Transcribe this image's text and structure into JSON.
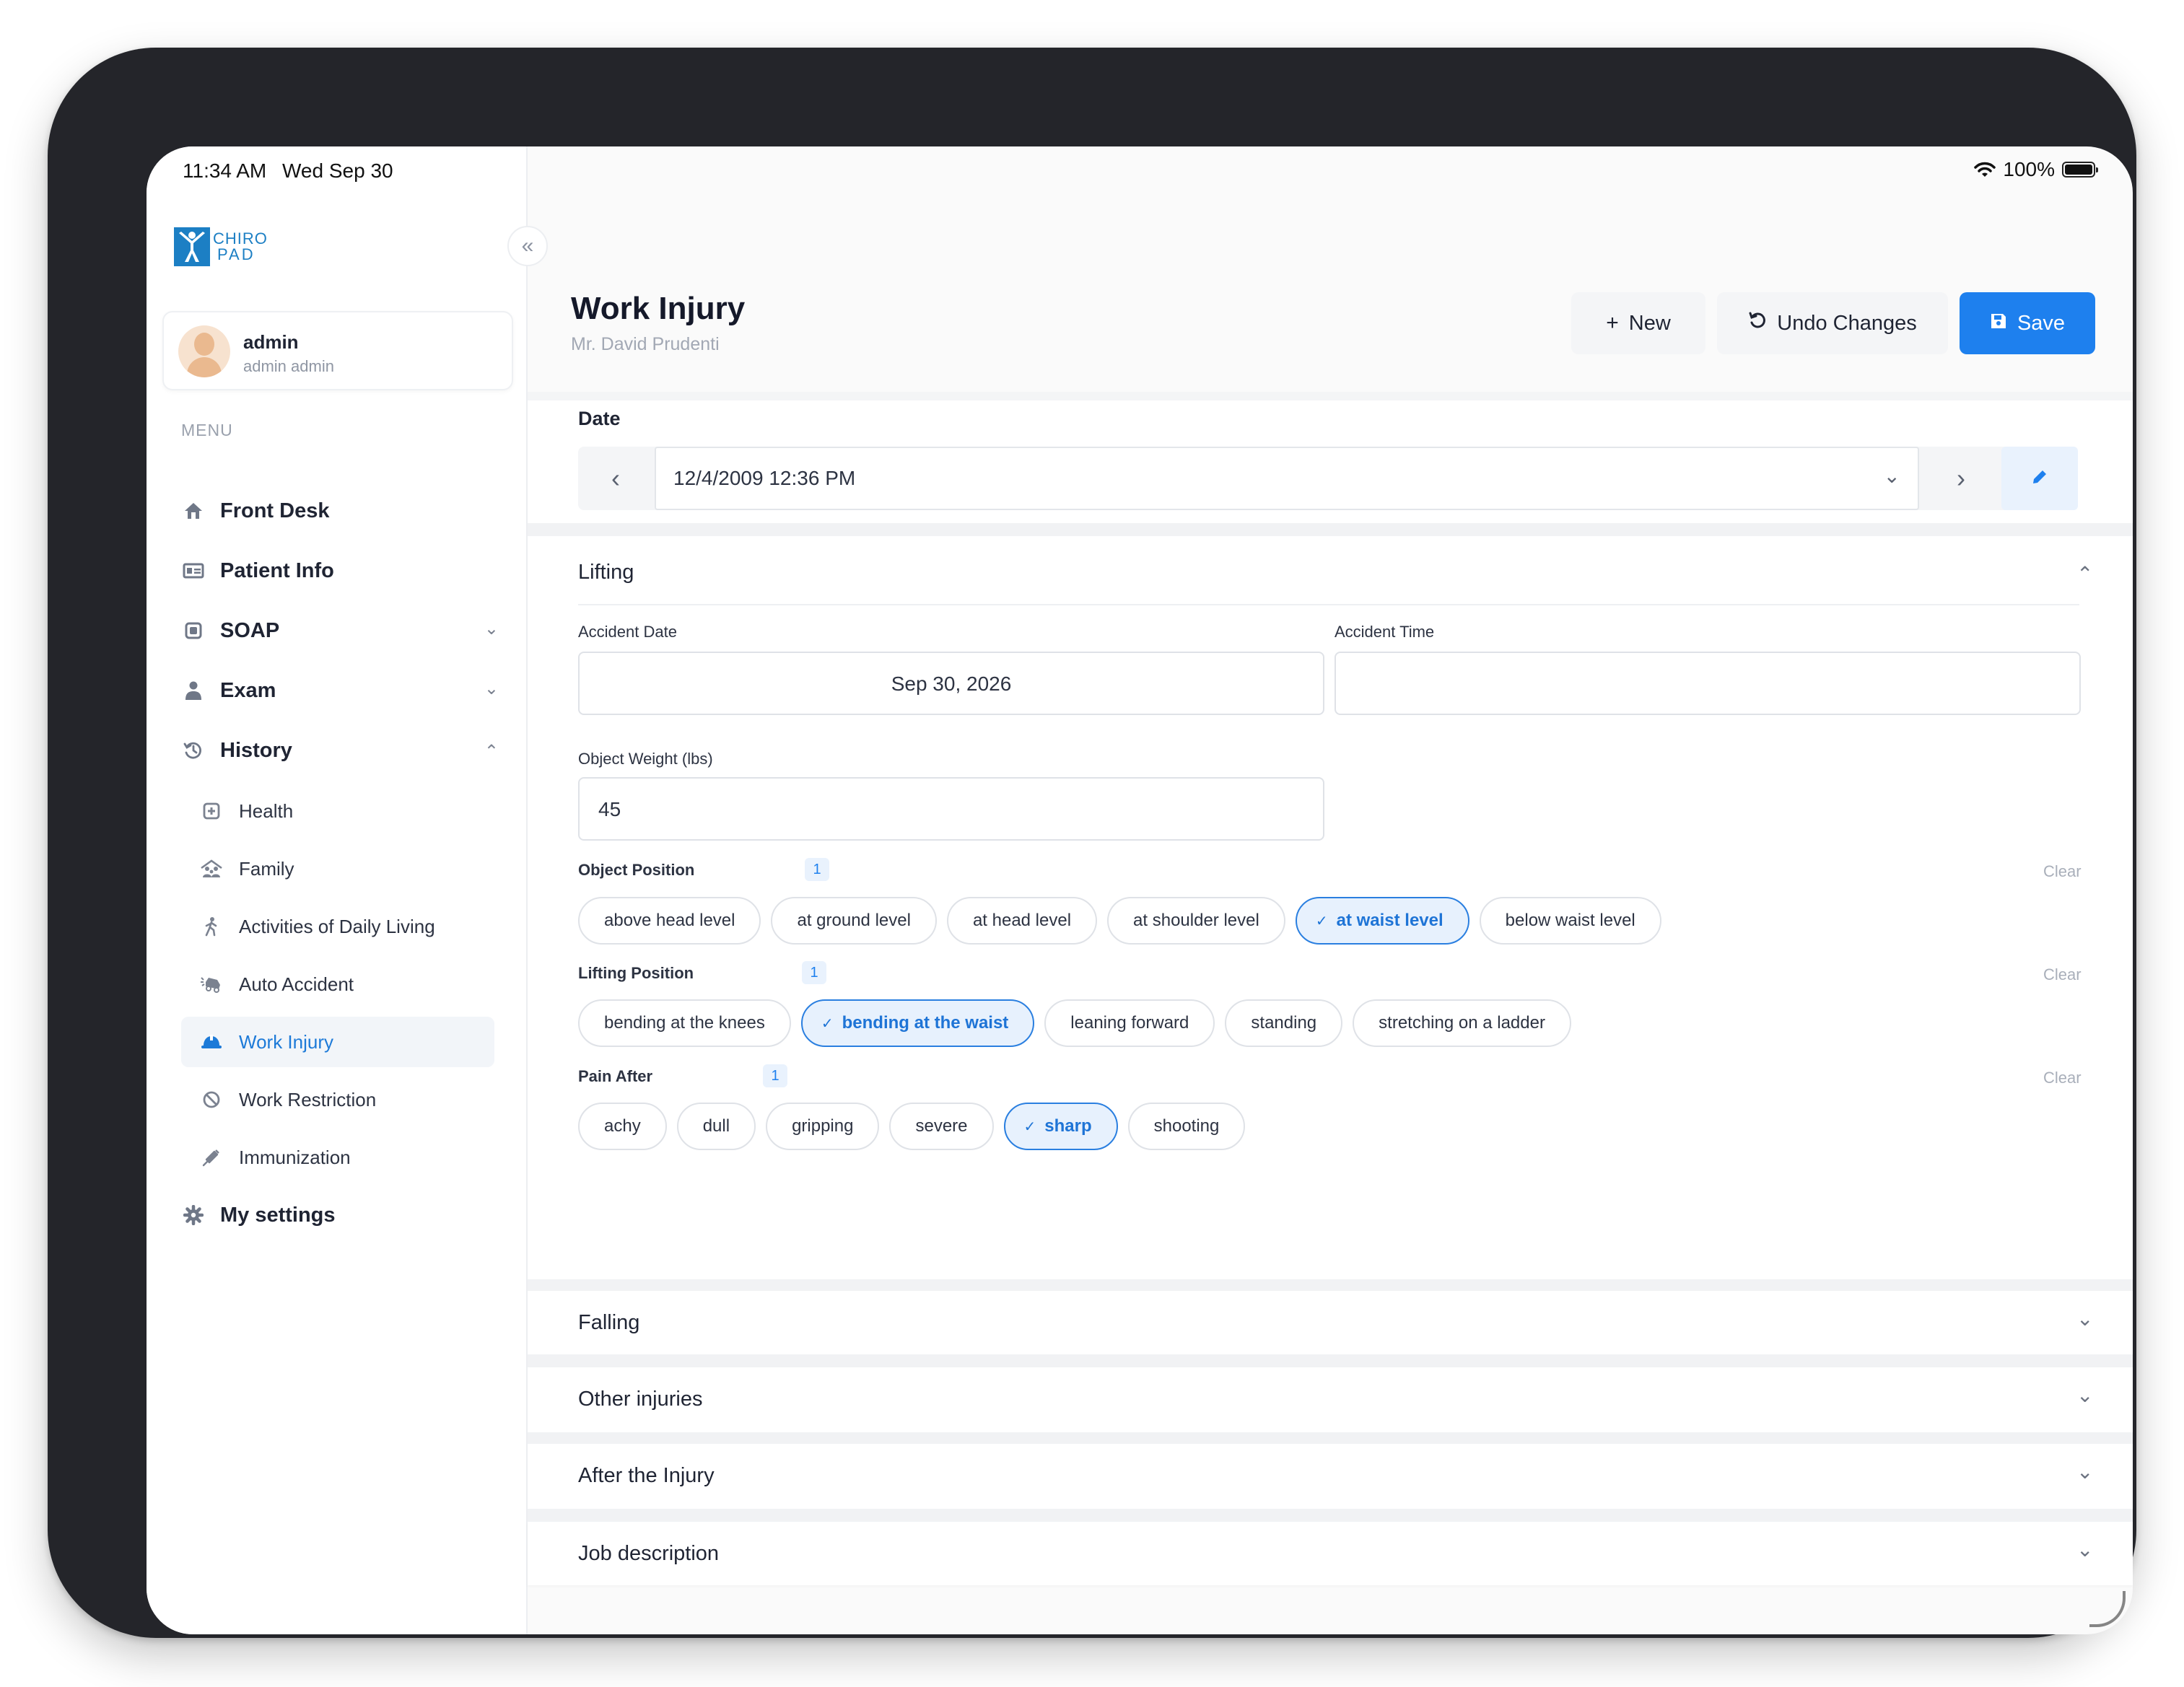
{
  "status_bar": {
    "time": "11:34 AM",
    "date": "Wed Sep 30",
    "battery": "100%"
  },
  "brand": {
    "line1": "CHIRO",
    "line2": "PAD"
  },
  "user": {
    "name": "admin",
    "subtitle": "admin admin"
  },
  "menu": {
    "title": "MENU",
    "items": [
      {
        "label": "Front Desk",
        "icon": "home-icon"
      },
      {
        "label": "Patient Info",
        "icon": "id-card-icon"
      },
      {
        "label": "SOAP",
        "icon": "clipboard-icon"
      },
      {
        "label": "Exam",
        "icon": "doctor-icon"
      },
      {
        "label": "History",
        "icon": "history-icon"
      },
      {
        "label": "My settings",
        "icon": "gear-icon"
      }
    ],
    "history_sub": [
      {
        "label": "Health",
        "icon": "medical-icon"
      },
      {
        "label": "Family",
        "icon": "family-icon"
      },
      {
        "label": "Activities of Daily Living",
        "icon": "walking-icon"
      },
      {
        "label": "Auto Accident",
        "icon": "car-crash-icon"
      },
      {
        "label": "Work Injury",
        "icon": "hard-hat-icon"
      },
      {
        "label": "Work Restriction",
        "icon": "ban-icon"
      },
      {
        "label": "Immunization",
        "icon": "syringe-icon"
      }
    ]
  },
  "header": {
    "title": "Work Injury",
    "patient": "Mr. David Prudenti",
    "new_label": "New",
    "undo_label": "Undo Changes",
    "save_label": "Save"
  },
  "date_section": {
    "label": "Date",
    "value": "12/4/2009 12:36 PM"
  },
  "lifting": {
    "title": "Lifting",
    "accident_date_label": "Accident Date",
    "accident_date_value": "Sep 30, 2026",
    "accident_time_label": "Accident Time",
    "accident_time_value": "",
    "object_weight_label": "Object Weight (lbs)",
    "object_weight_value": "45",
    "clear_label": "Clear",
    "object_position": {
      "label": "Object Position",
      "count": "1",
      "options": [
        "above head level",
        "at ground level",
        "at head level",
        "at shoulder level",
        "at waist level",
        "below waist level"
      ],
      "selected": "at waist level"
    },
    "lifting_position": {
      "label": "Lifting Position",
      "count": "1",
      "options": [
        "bending at the knees",
        "bending at the waist",
        "leaning forward",
        "standing",
        "stretching on a ladder"
      ],
      "selected": "bending at the waist"
    },
    "pain_after": {
      "label": "Pain After",
      "count": "1",
      "options": [
        "achy",
        "dull",
        "gripping",
        "severe",
        "sharp",
        "shooting"
      ],
      "selected": "sharp"
    }
  },
  "collapsed_sections": [
    "Falling",
    "Other injuries",
    "After the Injury",
    "Job description"
  ],
  "colors": {
    "accent": "#1e80ee",
    "selected_chip_bg": "#e7f1fd",
    "sidebar_active_bg": "#f2f5f9"
  }
}
